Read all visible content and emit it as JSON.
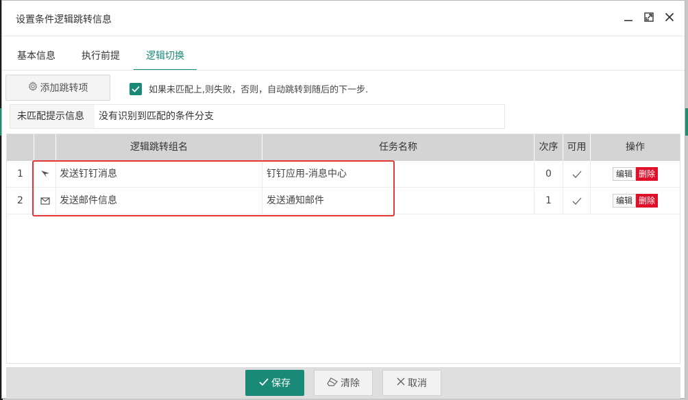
{
  "dialog": {
    "title": "设置条件逻辑跳转信息",
    "controls": [
      "minimize-icon",
      "maximize-icon",
      "close-icon"
    ]
  },
  "tabs": [
    {
      "label": "基本信息",
      "active": false
    },
    {
      "label": "执行前提",
      "active": false
    },
    {
      "label": "逻辑切换",
      "active": true
    }
  ],
  "toolbar": {
    "add_label": "添加跳转项",
    "checkbox_checked": true,
    "checkbox_label": "如果未匹配上,则失败，否则，自动跳转到随后的下一步."
  },
  "unmatched": {
    "label": "未匹配提示信息",
    "value": "没有识别到匹配的条件分支"
  },
  "grid": {
    "headers": {
      "name": "逻辑跳转组名",
      "task": "任务名称",
      "order": "次序",
      "available": "可用",
      "ops": "操作"
    },
    "rows": [
      {
        "num": "1",
        "icon": "send-icon",
        "name": "发送钉钉消息",
        "task": "钉钉应用-消息中心",
        "order": "0",
        "available": true,
        "edit": "编辑",
        "delete": "删除"
      },
      {
        "num": "2",
        "icon": "mail-icon",
        "name": "发送邮件信息",
        "task": "发送通知邮件",
        "order": "1",
        "available": true,
        "edit": "编辑",
        "delete": "删除"
      }
    ]
  },
  "footer": {
    "save": "保存",
    "clear": "清除",
    "cancel": "取消"
  },
  "colors": {
    "accent": "#1a8a78",
    "danger": "#e0102b",
    "highlight": "#e53535"
  }
}
